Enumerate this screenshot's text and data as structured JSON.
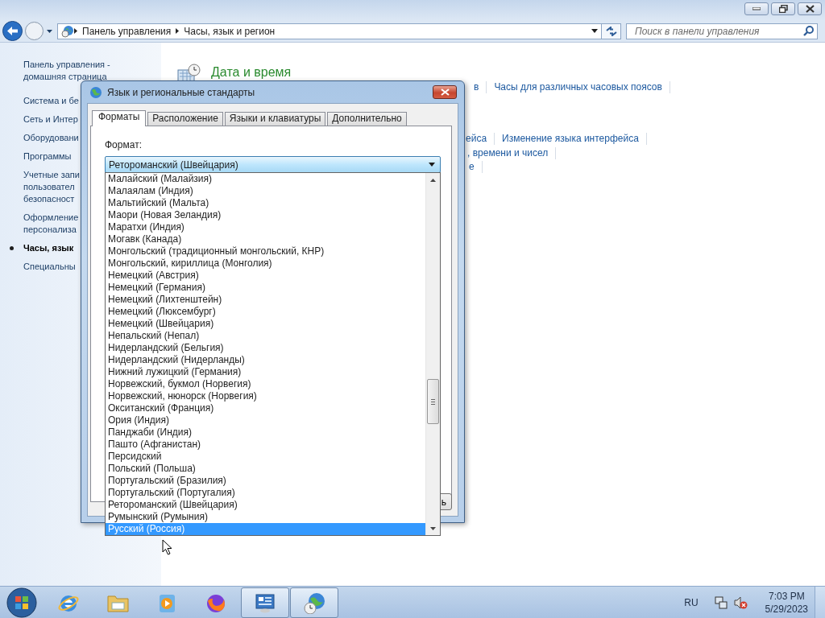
{
  "nav": {
    "breadcrumb": [
      "Панель управления",
      "Часы, язык и регион"
    ],
    "search": {
      "placeholder": "Поиск в панели управления"
    }
  },
  "sidebar": {
    "home": "Панель управления -\nдомашняя страница",
    "items": [
      {
        "text": "Система и бе",
        "selected": false
      },
      {
        "text": "Сеть и Интер",
        "selected": false
      },
      {
        "text": "Оборудовани",
        "selected": false
      },
      {
        "text": "Программы",
        "selected": false
      },
      {
        "text": "Учетные запи\nпользовател\nбезопасност",
        "selected": false
      },
      {
        "text": "Оформление\nперсонализа",
        "selected": false
      },
      {
        "text": "Часы, язык",
        "selected": true
      },
      {
        "text": "Специальны",
        "selected": false
      }
    ]
  },
  "content": {
    "title": "Дата и время",
    "link_rows": [
      [
        "в",
        "Часы для различных часовых поясов"
      ],
      [
        "ейса",
        "Изменение языка интерфейса"
      ],
      [
        ", времени и чисел"
      ],
      [
        "е"
      ]
    ]
  },
  "dialog": {
    "title": "Язык и региональные стандарты",
    "tabs": [
      {
        "label": "Форматы",
        "selected": true
      },
      {
        "label": "Расположение",
        "selected": false
      },
      {
        "label": "Языки и клавиатуры",
        "selected": false
      },
      {
        "label": "Дополнительно",
        "selected": false
      }
    ],
    "format_label": "Формат:",
    "format_value": "Ретороманский (Швейцария)",
    "button": "ь",
    "dropdown": {
      "items": [
        {
          "text": "Малайский (Малайзия)",
          "selected": false
        },
        {
          "text": "Малаялам (Индия)",
          "selected": false
        },
        {
          "text": "Мальтийский (Мальта)",
          "selected": false
        },
        {
          "text": "Маори (Новая Зеландия)",
          "selected": false
        },
        {
          "text": "Маратхи (Индия)",
          "selected": false
        },
        {
          "text": "Могавк (Канада)",
          "selected": false
        },
        {
          "text": "Монгольский (традиционный монгольский, КНР)",
          "selected": false
        },
        {
          "text": "Монгольский, кириллица (Монголия)",
          "selected": false
        },
        {
          "text": "Немецкий (Австрия)",
          "selected": false
        },
        {
          "text": "Немецкий (Германия)",
          "selected": false
        },
        {
          "text": "Немецкий (Лихтенштейн)",
          "selected": false
        },
        {
          "text": "Немецкий (Люксембург)",
          "selected": false
        },
        {
          "text": "Немецкий (Швейцария)",
          "selected": false
        },
        {
          "text": "Непальский (Непал)",
          "selected": false
        },
        {
          "text": "Нидерландский (Бельгия)",
          "selected": false
        },
        {
          "text": "Нидерландский (Нидерланды)",
          "selected": false
        },
        {
          "text": "Нижний лужицкий (Германия)",
          "selected": false
        },
        {
          "text": "Норвежский, букмол (Норвегия)",
          "selected": false
        },
        {
          "text": "Норвежский, нюнорск (Норвегия)",
          "selected": false
        },
        {
          "text": "Окситанский (Франция)",
          "selected": false
        },
        {
          "text": "Ория (Индия)",
          "selected": false
        },
        {
          "text": "Панджаби (Индия)",
          "selected": false
        },
        {
          "text": "Пашто (Афганистан)",
          "selected": false
        },
        {
          "text": "Персидский",
          "selected": false
        },
        {
          "text": "Польский (Польша)",
          "selected": false
        },
        {
          "text": "Португальский (Бразилия)",
          "selected": false
        },
        {
          "text": "Португальский (Португалия)",
          "selected": false
        },
        {
          "text": "Ретороманский (Швейцария)",
          "selected": false
        },
        {
          "text": "Румынский (Румыния)",
          "selected": false
        },
        {
          "text": "Русский (Россия)",
          "selected": true
        }
      ]
    }
  },
  "taskbar": {
    "apps": [
      {
        "kind": "ie",
        "active": false
      },
      {
        "kind": "folder",
        "active": false
      },
      {
        "kind": "media",
        "active": false
      },
      {
        "kind": "firefox",
        "active": false
      },
      {
        "kind": "panel",
        "active": true
      },
      {
        "kind": "globe",
        "active": true
      }
    ],
    "language": "RU",
    "time": "7:03 PM",
    "date": "5/29/2023"
  }
}
